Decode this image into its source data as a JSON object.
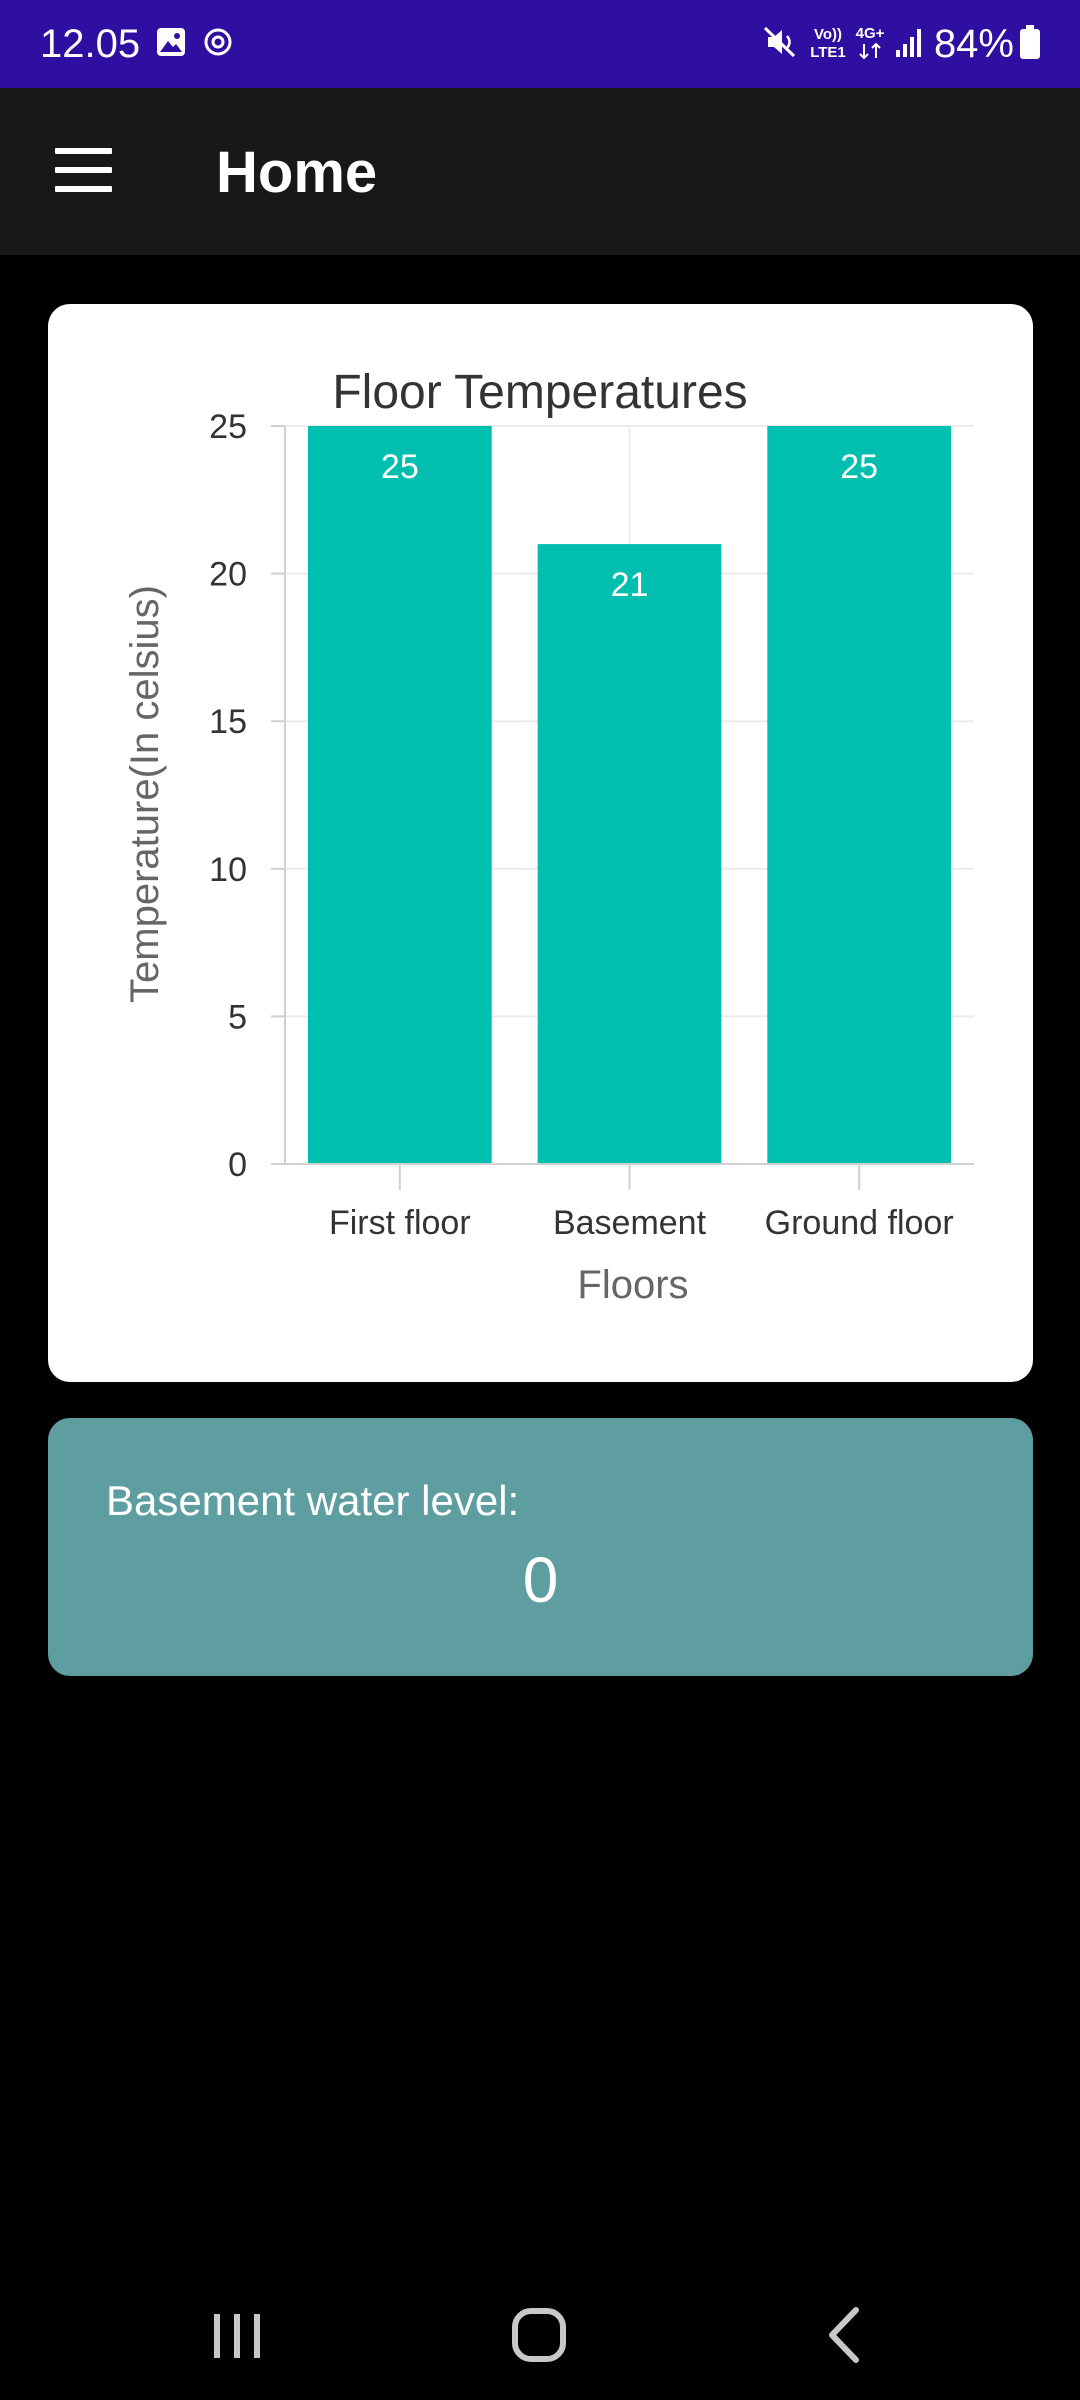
{
  "status_bar": {
    "time": "12.05",
    "battery": "84%",
    "icons": [
      "gallery-icon",
      "sync-icon",
      "mute-icon",
      "volte-icon",
      "4g-icon",
      "signal-icon",
      "battery-icon"
    ],
    "volte_top": "Vo))",
    "volte_bottom": "LTE1",
    "network_label": "4G+"
  },
  "app_bar": {
    "title": "Home",
    "menu_icon": "hamburger-menu-icon"
  },
  "chart_data": {
    "type": "bar",
    "title": "Floor Temperatures",
    "xlabel": "Floors",
    "ylabel": "Temperature(In celsius)",
    "categories": [
      "First floor",
      "Basement",
      "Ground floor"
    ],
    "values": [
      25,
      21,
      25
    ],
    "data_labels": [
      "25",
      "21",
      "25"
    ],
    "ylim": [
      0,
      25
    ],
    "yticks": [
      0,
      5,
      10,
      15,
      20,
      25
    ],
    "ytick_labels": [
      "0",
      "5",
      "10",
      "15",
      "20",
      "25"
    ],
    "grid": true,
    "bar_color": "#00bfae"
  },
  "water": {
    "label": "Basement water level:",
    "value": "0"
  },
  "nav_bar": {
    "recents_icon": "recents-icon",
    "home_icon": "home-icon",
    "back_icon": "back-icon"
  },
  "colors": {
    "status_bar": "#2f0fa1",
    "app_bar": "#181818",
    "background": "#000000",
    "water_card": "#5f9ea0",
    "bar": "#00bfae"
  }
}
